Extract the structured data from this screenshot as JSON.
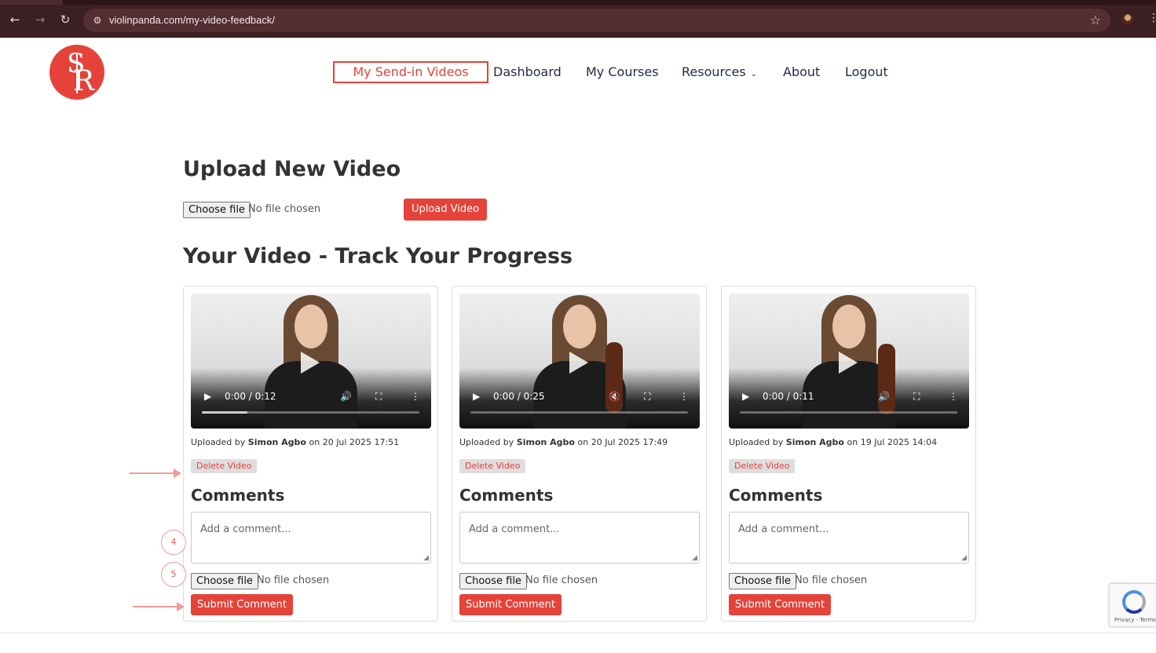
{
  "browser": {
    "url": "violinpanda.com/my-video-feedback/",
    "back_icon": "←",
    "forward_icon": "→",
    "reload_icon": "↻",
    "tune_icon": "⚙",
    "star_icon": "☆",
    "menu_icon": "⋮"
  },
  "nav": {
    "items": [
      {
        "label": "My Send-in Videos",
        "active": true
      },
      {
        "label": "Dashboard"
      },
      {
        "label": "My Courses"
      },
      {
        "label": "Resources"
      },
      {
        "label": "About"
      },
      {
        "label": "Logout"
      }
    ],
    "chevron": "⌄"
  },
  "logo": {
    "s": "S",
    "r": "R"
  },
  "upload": {
    "title": "Upload New Video",
    "choose_label": "Choose file",
    "no_file": "No file chosen",
    "button_label": "Upload Video"
  },
  "progress_section": {
    "title": "Your Video - Track Your Progress"
  },
  "videos": [
    {
      "time": "0:00 / 0:12",
      "progress": 0.21,
      "muted": false,
      "uploaded_by_prefix": "Uploaded by",
      "uploader": "Simon Agbo",
      "uploaded_on": "on 20 Jul 2025 17:51",
      "delete_label": "Delete Video",
      "comments_title": "Comments",
      "comment_placeholder": "Add a comment...",
      "choose_label": "Choose file",
      "no_file": "No file chosen",
      "submit_label": "Submit Comment"
    },
    {
      "time": "0:00 / 0:25",
      "progress": 0.0,
      "muted": true,
      "uploaded_by_prefix": "Uploaded by",
      "uploader": "Simon Agbo",
      "uploaded_on": "on 20 Jul 2025 17:49",
      "delete_label": "Delete Video",
      "comments_title": "Comments",
      "comment_placeholder": "Add a comment...",
      "choose_label": "Choose file",
      "no_file": "No file chosen",
      "submit_label": "Submit Comment"
    },
    {
      "time": "0:00 / 0:11",
      "progress": 0.0,
      "muted": false,
      "uploaded_by_prefix": "Uploaded by",
      "uploader": "Simon Agbo",
      "uploaded_on": "on 19 Jul 2025 14:04",
      "delete_label": "Delete Video",
      "comments_title": "Comments",
      "comment_placeholder": "Add a comment...",
      "choose_label": "Choose file",
      "no_file": "No file chosen",
      "submit_label": "Submit Comment"
    }
  ],
  "player_icons": {
    "play": "▶",
    "volume": "🔊",
    "muted": "🔇",
    "fullscreen": "⛶",
    "more": "⋮",
    "resize": "◢"
  },
  "annotations": {
    "step_a": "4",
    "step_b": "5"
  },
  "recaptcha": {
    "text": "Privacy - Terms"
  },
  "colors": {
    "accent": "#e5433a",
    "chrome": "#3b1f22",
    "nav_text": "#1f2a44"
  }
}
